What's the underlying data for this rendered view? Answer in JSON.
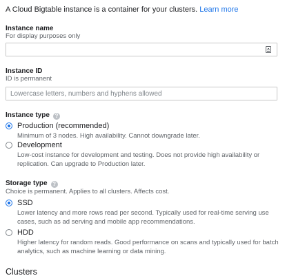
{
  "intro": {
    "text": "A Cloud Bigtable instance is a container for your clusters.",
    "link": "Learn more"
  },
  "instance_name": {
    "label": "Instance name",
    "hint": "For display purposes only",
    "value": "",
    "placeholder": "",
    "icon": "autofill-contact-icon"
  },
  "instance_id": {
    "label": "Instance ID",
    "hint": "ID is permanent",
    "value": "",
    "placeholder": "Lowercase letters, numbers and hyphens allowed"
  },
  "instance_type": {
    "label": "Instance type",
    "help_icon": "help-icon",
    "options": [
      {
        "label": "Production (recommended)",
        "description": "Minimum of 3 nodes. High availability. Cannot downgrade later.",
        "selected": true
      },
      {
        "label": "Development",
        "description": "Low-cost instance for development and testing. Does not provide high availability or replication. Can upgrade to Production later.",
        "selected": false
      }
    ]
  },
  "storage_type": {
    "label": "Storage type",
    "help_icon": "help-icon",
    "hint": "Choice is permanent. Applies to all clusters. Affects cost.",
    "options": [
      {
        "label": "SSD",
        "description": "Lower latency and more rows read per second. Typically used for real-time serving use cases, such as ad serving and mobile app recommendations.",
        "selected": true
      },
      {
        "label": "HDD",
        "description": "Higher latency for random reads. Good performance on scans and typically used for batch analytics, such as machine learning or data mining.",
        "selected": false
      }
    ]
  },
  "clusters": {
    "heading": "Clusters"
  },
  "colors": {
    "accent": "#1a73e8",
    "text": "#202124",
    "secondary_text": "#5f6368",
    "border": "#c6c6c6"
  }
}
